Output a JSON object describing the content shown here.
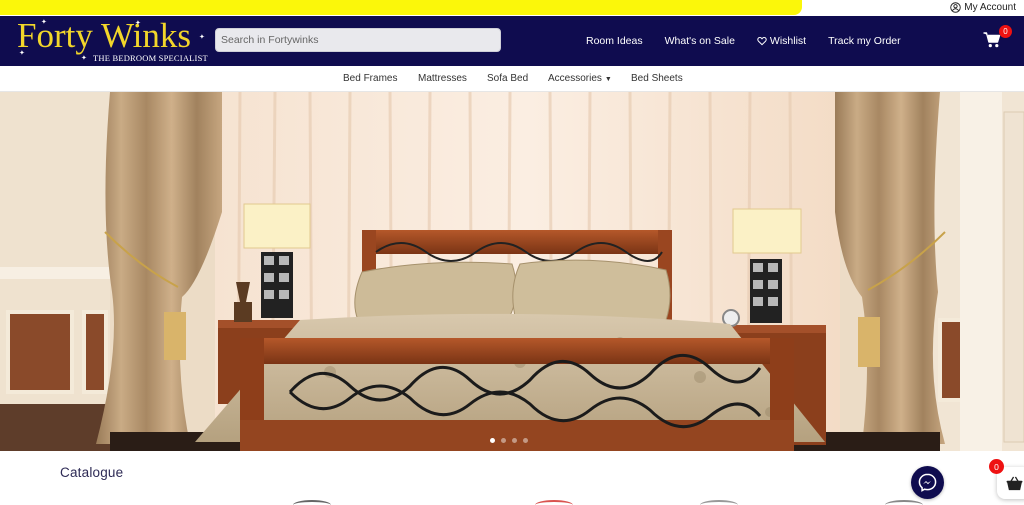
{
  "promo_bar": {
    "color": "#fbf70a"
  },
  "account": {
    "label": "My Account",
    "icon": "user-circle-icon"
  },
  "header": {
    "background": "#0f0c4f",
    "logo": {
      "name": "Forty Winks",
      "tagline": "THE BEDROOM SPECIALIST"
    },
    "search": {
      "placeholder": "Search in Fortywinks",
      "value": ""
    },
    "nav": [
      {
        "label": "Room Ideas"
      },
      {
        "label": "What's on Sale"
      },
      {
        "label": "Wishlist",
        "icon": "heart-icon"
      },
      {
        "label": "Track my Order"
      }
    ],
    "cart": {
      "icon": "shopping-cart-icon",
      "count": "0"
    }
  },
  "categories": [
    {
      "label": "Bed Frames"
    },
    {
      "label": "Mattresses"
    },
    {
      "label": "Sofa Bed"
    },
    {
      "label": "Accessories",
      "has_dropdown": true
    },
    {
      "label": "Bed Sheets"
    }
  ],
  "hero": {
    "image": "bedroom-with-wooden-bed",
    "slides": 4,
    "active_slide": 1
  },
  "catalogue": {
    "title": "Catalogue"
  },
  "floating": {
    "messenger_icon": "messenger-icon",
    "cart_icon": "shopping-basket-icon",
    "cart_count": "0"
  }
}
